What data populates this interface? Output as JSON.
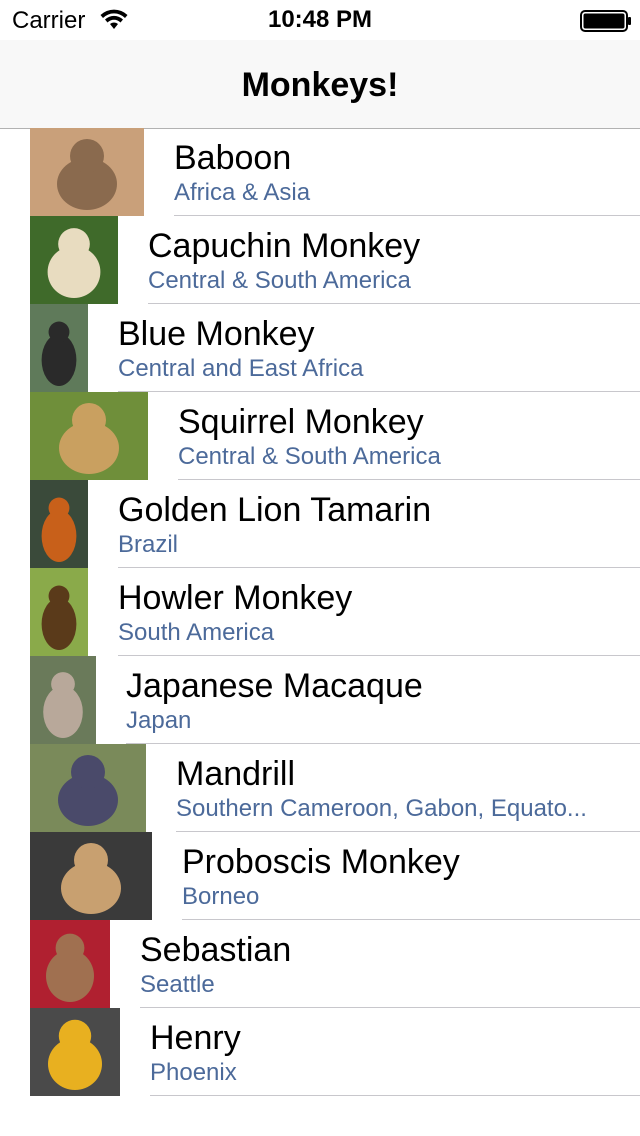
{
  "status_bar": {
    "carrier": "Carrier",
    "time": "10:48 PM",
    "icons": [
      "wifi-icon",
      "battery-icon"
    ]
  },
  "nav": {
    "title": "Monkeys!"
  },
  "monkeys": [
    {
      "name": "Baboon",
      "location": "Africa & Asia",
      "thumb_colors": [
        "#c9a07a",
        "#8a6a4e"
      ]
    },
    {
      "name": "Capuchin Monkey",
      "location": "Central & South America",
      "thumb_colors": [
        "#3f6a2a",
        "#e8dcc0"
      ]
    },
    {
      "name": "Blue Monkey",
      "location": "Central and East Africa",
      "thumb_colors": [
        "#5f7a5a",
        "#2a2a2a"
      ]
    },
    {
      "name": "Squirrel Monkey",
      "location": "Central & South America",
      "thumb_colors": [
        "#6f8f3a",
        "#c9a060"
      ]
    },
    {
      "name": "Golden Lion Tamarin",
      "location": "Brazil",
      "thumb_colors": [
        "#3a4a3a",
        "#c8601a"
      ]
    },
    {
      "name": "Howler Monkey",
      "location": "South America",
      "thumb_colors": [
        "#8aaa4a",
        "#5a3a1a"
      ]
    },
    {
      "name": "Japanese Macaque",
      "location": "Japan",
      "thumb_colors": [
        "#6a7a5a",
        "#b8a89a"
      ]
    },
    {
      "name": "Mandrill",
      "location": "Southern Cameroon, Gabon, Equato...",
      "thumb_colors": [
        "#7a8a5a",
        "#4a4a6a"
      ]
    },
    {
      "name": "Proboscis Monkey",
      "location": "Borneo",
      "thumb_colors": [
        "#3a3a3a",
        "#c8a070"
      ]
    },
    {
      "name": "Sebastian",
      "location": "Seattle",
      "thumb_colors": [
        "#b02030",
        "#a07050"
      ]
    },
    {
      "name": "Henry",
      "location": "Phoenix",
      "thumb_colors": [
        "#4a4a4a",
        "#e8b020"
      ]
    }
  ]
}
